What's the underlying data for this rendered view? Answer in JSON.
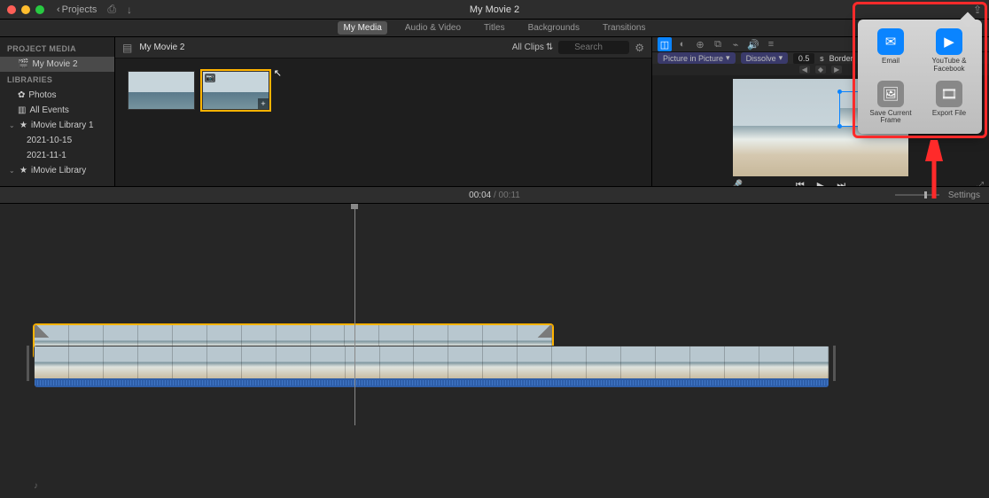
{
  "titlebar": {
    "back_label": "Projects",
    "title": "My Movie 2"
  },
  "tabs": {
    "my_media": "My Media",
    "audio_video": "Audio & Video",
    "titles": "Titles",
    "backgrounds": "Backgrounds",
    "transitions": "Transitions"
  },
  "sidebar": {
    "project_media": "PROJECT MEDIA",
    "my_movie": "My Movie 2",
    "libraries": "LIBRARIES",
    "photos": "Photos",
    "all_events": "All Events",
    "imovie_lib1": "iMovie Library 1",
    "date1": "2021-10-15",
    "date2": "2021-11-1",
    "imovie_lib": "iMovie Library"
  },
  "media_browser": {
    "title": "My Movie 2",
    "all_clips": "All Clips",
    "search_placeholder": "Search"
  },
  "preview": {
    "pip": "Picture in Picture",
    "dissolve": "Dissolve",
    "duration": "0.5",
    "seconds": "s",
    "border": "Border:"
  },
  "timecode": {
    "current": "00:04",
    "sep": " / ",
    "duration": "00:11"
  },
  "settings_label": "Settings",
  "share": {
    "email": "Email",
    "youtube": "YouTube & Facebook",
    "save_frame": "Save Current Frame",
    "export_file": "Export File"
  }
}
